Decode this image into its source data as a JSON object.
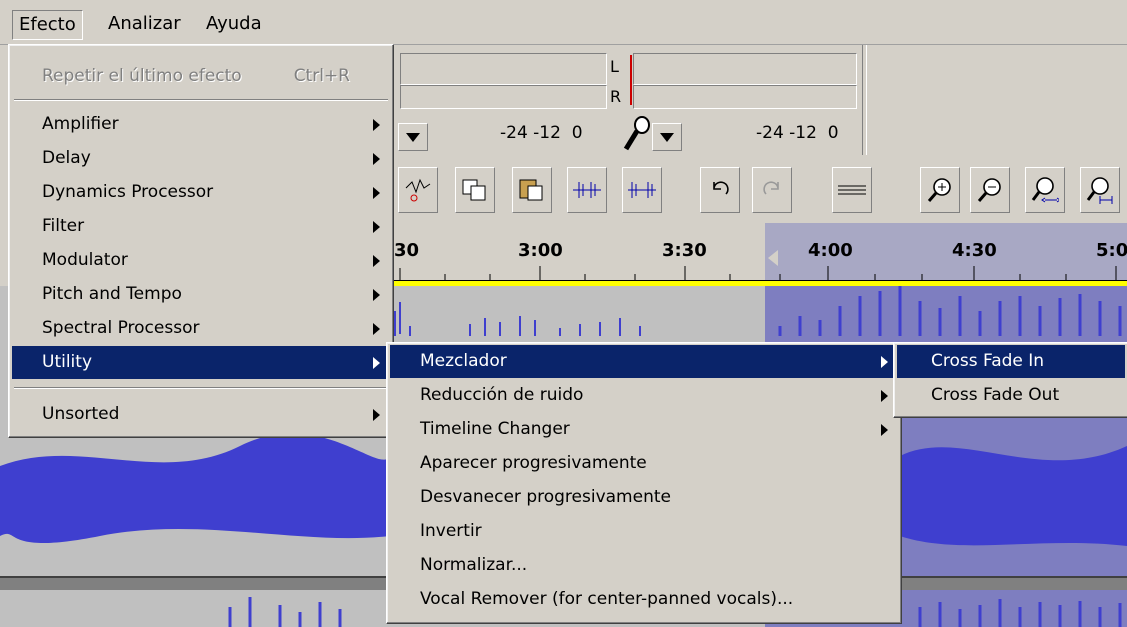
{
  "menubar": {
    "items": [
      "Efecto",
      "Analizar",
      "Ayuda"
    ]
  },
  "meter": {
    "left_label": "L",
    "right_label": "R",
    "scale_out": "-24 -12  0",
    "scale_in": "-24 -12  0"
  },
  "ruler": {
    "ticks": [
      "30",
      "3:00",
      "3:30",
      "4:00",
      "4:30",
      "5:0"
    ]
  },
  "effect_menu": {
    "repeat": {
      "label": "Repetir el último efecto",
      "shortcut": "Ctrl+R"
    },
    "items": [
      "Amplifier",
      "Delay",
      "Dynamics Processor",
      "Filter",
      "Modulator",
      "Pitch and Tempo",
      "Spectral Processor",
      "Utility"
    ],
    "unsorted": "Unsorted"
  },
  "utility_menu": {
    "items": [
      "Mezclador",
      "Reducción de ruido",
      "Timeline Changer",
      "Aparecer progresivamente",
      "Desvanecer progresivamente",
      "Invertir",
      "Normalizar...",
      "Vocal Remover (for center-panned vocals)..."
    ]
  },
  "mezclador_menu": {
    "items": [
      "Cross Fade In",
      "Cross Fade Out"
    ]
  },
  "colors": {
    "menu_highlight": "#0a246a",
    "waveform": "#3f3fcf",
    "selection": "#7e7ec0"
  }
}
